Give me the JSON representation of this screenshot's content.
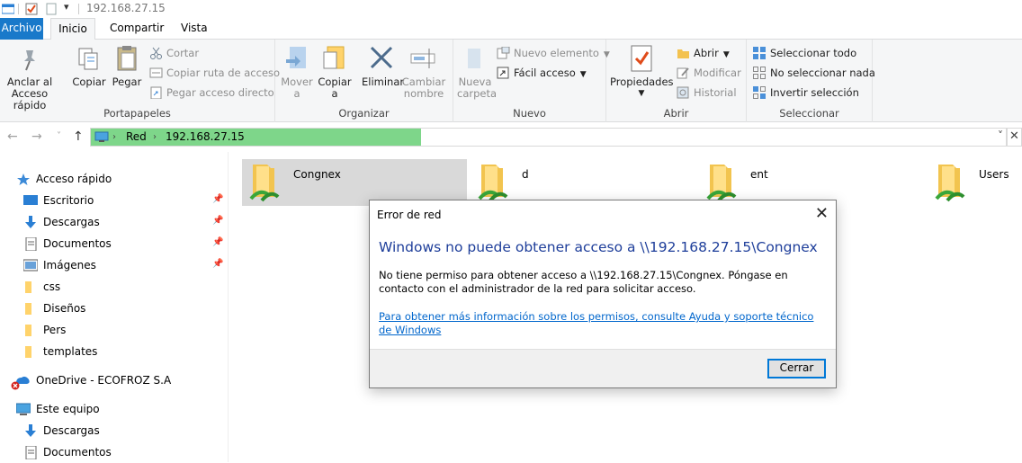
{
  "window": {
    "title": "192.168.27.15"
  },
  "tabs": [
    {
      "label": "Archivo"
    },
    {
      "label": "Inicio"
    },
    {
      "label": "Compartir"
    },
    {
      "label": "Vista"
    }
  ],
  "ribbon": {
    "portapapeles": {
      "label": "Portapapeles",
      "anclar": "Anclar al",
      "anclar2": "Acceso rápido",
      "copiar": "Copiar",
      "pegar": "Pegar",
      "cortar": "Cortar",
      "copiar_ruta": "Copiar ruta de acceso",
      "pegar_acceso": "Pegar acceso directo"
    },
    "organizar": {
      "label": "Organizar",
      "mover": "Mover",
      "mover2": "a",
      "copiar": "Copiar",
      "copiar2": "a",
      "eliminar": "Eliminar",
      "cambiar": "Cambiar",
      "cambiar2": "nombre"
    },
    "nuevo": {
      "label": "Nuevo",
      "nueva": "Nueva",
      "nueva2": "carpeta",
      "nuevo_elemento": "Nuevo elemento",
      "facil_acceso": "Fácil acceso"
    },
    "abrir": {
      "label": "Abrir",
      "propiedades": "Propiedades",
      "abrir": "Abrir",
      "modificar": "Modificar",
      "historial": "Historial"
    },
    "seleccionar": {
      "label": "Seleccionar",
      "todo": "Seleccionar todo",
      "nada": "No seleccionar nada",
      "invertir": "Invertir selección"
    }
  },
  "address": {
    "crumbs": [
      "Red",
      "192.168.27.15"
    ]
  },
  "sidebar": {
    "items": [
      {
        "label": "Acceso rápido"
      },
      {
        "label": "Escritorio"
      },
      {
        "label": "Descargas"
      },
      {
        "label": "Documentos"
      },
      {
        "label": "Imágenes"
      },
      {
        "label": "css"
      },
      {
        "label": "Diseños"
      },
      {
        "label": "Pers"
      },
      {
        "label": "templates"
      },
      {
        "label": "OneDrive - ECOFROZ S.A"
      },
      {
        "label": "Este equipo"
      },
      {
        "label": "Descargas"
      },
      {
        "label": "Documentos"
      }
    ]
  },
  "files": [
    {
      "name": "Congnex"
    },
    {
      "name": "d"
    },
    {
      "name": "ent"
    },
    {
      "name": "Users"
    }
  ],
  "dialog": {
    "title": "Error de red",
    "heading": "Windows no puede obtener acceso a \\\\192.168.27.15\\Congnex",
    "message": "No tiene permiso para obtener acceso a \\\\192.168.27.15\\Congnex. Póngase en contacto con el administrador de la red para solicitar acceso.",
    "link": "Para obtener más información sobre los permisos, consulte Ayuda y soporte técnico de Windows",
    "button": "Cerrar"
  },
  "colors": {
    "file_tab": "#1979ca",
    "address_highlight": "#7ed68a",
    "dialog_heading": "#1e3e9a",
    "link": "#0066cc"
  }
}
